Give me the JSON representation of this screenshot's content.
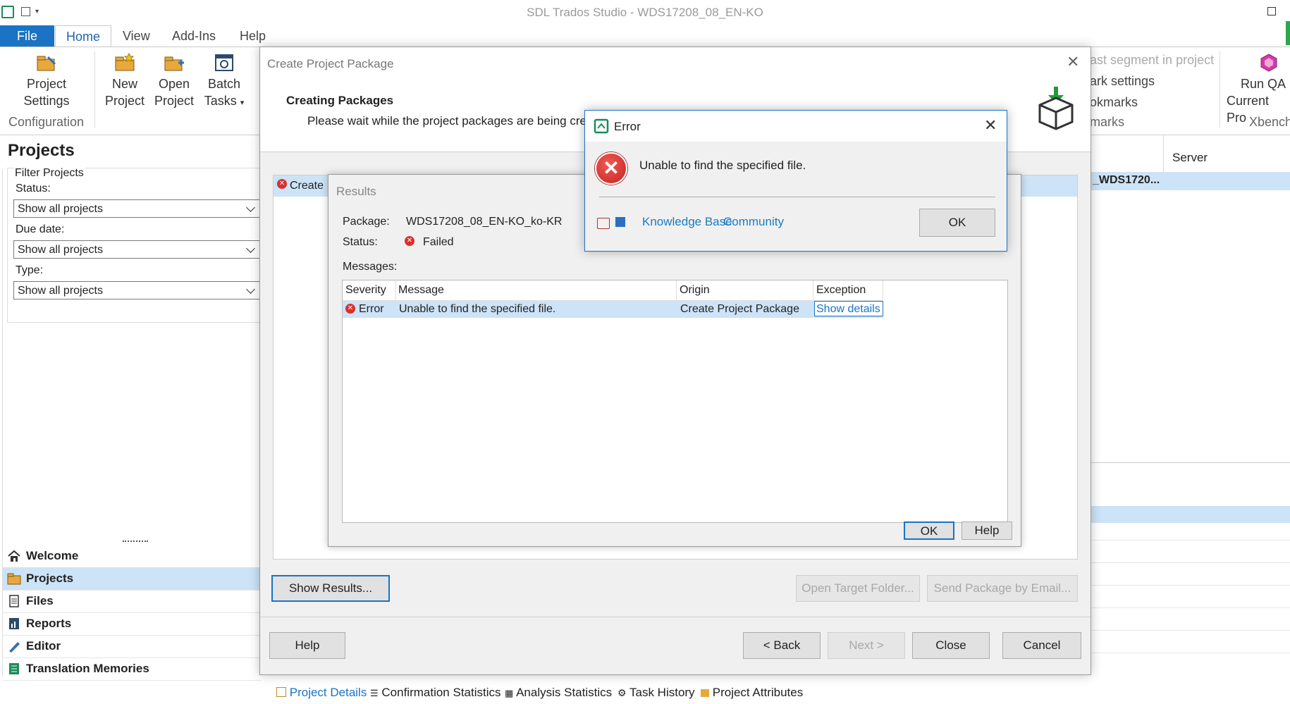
{
  "window": {
    "title": "SDL Trados Studio - WDS17208_08_EN-KO"
  },
  "ribbon_tabs": [
    "File",
    "Home",
    "View",
    "Add-Ins",
    "Help"
  ],
  "ribbon": {
    "project_settings": [
      "Project",
      "Settings"
    ],
    "configuration_label": "Configuration",
    "new_project": [
      "New",
      "Project"
    ],
    "open_project": [
      "Open",
      "Project"
    ],
    "batch_tasks": [
      "Batch",
      "Tasks"
    ],
    "right_items": [
      "ast segment in project",
      "ark settings",
      "okmarks",
      "marks"
    ],
    "run_qa": [
      "Run QA",
      "Current Pro"
    ],
    "xbench_label": "Xbench"
  },
  "projects_pane": {
    "heading": "Projects",
    "filter_title": "Filter Projects",
    "status_label": "Status:",
    "status_value": "Show all projects",
    "due_label": "Due date:",
    "due_value": "Show all projects",
    "type_label": "Type:",
    "type_value": "Show all projects"
  },
  "nav": [
    "Welcome",
    "Projects",
    "Files",
    "Reports",
    "Editor",
    "Translation Memories"
  ],
  "right_pane": {
    "server_header": "Server",
    "row_value": "_WDS1720..."
  },
  "main_dialog": {
    "title": "Create Project Package",
    "heading": "Creating Packages",
    "subtext": "Please wait while the project packages are being cre",
    "task_row": "Create",
    "show_results": "Show Results...",
    "open_target_folder": "Open Target Folder...",
    "send_package": "Send Package by Email...",
    "help": "Help",
    "back": "< Back",
    "next": "Next >",
    "close": "Close",
    "cancel": "Cancel"
  },
  "results_dialog": {
    "title": "Results",
    "package_label": "Package:",
    "package_value": "WDS17208_08_EN-KO_ko-KR",
    "status_label": "Status:",
    "status_value": "Failed",
    "messages_label": "Messages:",
    "columns": [
      "Severity",
      "Message",
      "Origin",
      "Exception"
    ],
    "row": {
      "severity": "Error",
      "message": "Unable to find the specified file.",
      "origin": "Create Project Package",
      "exception": "Show details"
    },
    "ok": "OK",
    "help": "Help"
  },
  "error_dialog": {
    "title": "Error",
    "message": "Unable to find the specified file.",
    "kb_link": "Knowledge Base",
    "community_link": "Community",
    "ok": "OK"
  },
  "bottom_tabs": [
    "Project Details",
    "Confirmation Statistics",
    "Analysis Statistics",
    "Task History",
    "Project Attributes"
  ],
  "colors": {
    "accent": "#1a73c4",
    "selection": "#cde3f7",
    "error": "#d9302c"
  }
}
